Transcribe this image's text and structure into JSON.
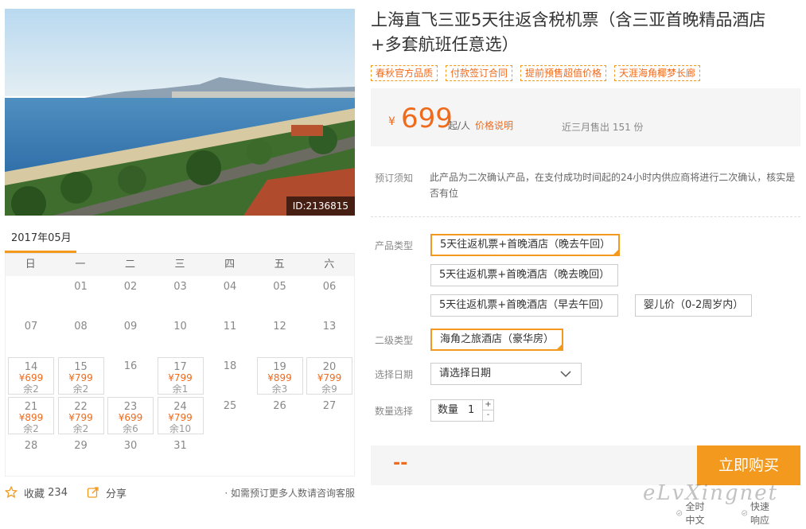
{
  "photo": {
    "id_label": "ID:2136815"
  },
  "title": "上海直飞三亚5天往返含税机票（含三亚首晚精品酒店+多套航班任意选）",
  "tags": [
    "春秋官方品质",
    "付款签订合同",
    "提前预售超值价格",
    "天涯海角椰梦长廊"
  ],
  "price": {
    "yen": "¥",
    "amount": "699",
    "unit": "起/人",
    "link": "价格说明",
    "sold": "近三月售出 151 份"
  },
  "notice": {
    "label": "预订须知",
    "text": "此产品为二次确认产品，在支付成功时间起的24小时内供应商将进行二次确认，核实是否有位"
  },
  "product_type": {
    "label": "产品类型",
    "options": [
      "5天往返机票+首晚酒店（晚去午回）",
      "5天往返机票+首晚酒店（晚去晚回）",
      "5天往返机票+首晚酒店（早去午回）",
      "婴儿价（0-2周岁内）"
    ],
    "selected_index": 0
  },
  "sub_type": {
    "label": "二级类型",
    "options": [
      "海角之旅酒店（豪华房）"
    ],
    "selected_index": 0
  },
  "date": {
    "label": "选择日期",
    "placeholder": "请选择日期"
  },
  "quantity": {
    "label": "数量选择",
    "prefix": "数量",
    "value": "1",
    "plus": "+",
    "minus": "-"
  },
  "buy": {
    "total": "--",
    "button": "立即购买"
  },
  "calendar": {
    "month": "2017年05月",
    "weekdays": [
      "日",
      "一",
      "二",
      "三",
      "四",
      "五",
      "六"
    ],
    "weeks": [
      [
        null,
        {
          "d": "01"
        },
        {
          "d": "02"
        },
        {
          "d": "03"
        },
        {
          "d": "04"
        },
        {
          "d": "05"
        },
        {
          "d": "06"
        }
      ],
      [
        {
          "d": "07"
        },
        {
          "d": "08"
        },
        {
          "d": "09"
        },
        {
          "d": "10"
        },
        {
          "d": "11"
        },
        {
          "d": "12"
        },
        {
          "d": "13"
        }
      ],
      [
        {
          "d": "14",
          "p": "¥699",
          "r": "余2"
        },
        {
          "d": "15",
          "p": "¥799",
          "r": "余2"
        },
        {
          "d": "16"
        },
        {
          "d": "17",
          "p": "¥799",
          "r": "余1"
        },
        {
          "d": "18"
        },
        {
          "d": "19",
          "p": "¥899",
          "r": "余3"
        },
        {
          "d": "20",
          "p": "¥799",
          "r": "余9"
        }
      ],
      [
        {
          "d": "21",
          "p": "¥899",
          "r": "余2"
        },
        {
          "d": "22",
          "p": "¥799",
          "r": "余2"
        },
        {
          "d": "23",
          "p": "¥699",
          "r": "余6"
        },
        {
          "d": "24",
          "p": "¥799",
          "r": "余10"
        },
        {
          "d": "25"
        },
        {
          "d": "26"
        },
        {
          "d": "27"
        }
      ],
      [
        {
          "d": "28"
        },
        {
          "d": "29"
        },
        {
          "d": "30"
        },
        {
          "d": "31"
        },
        null,
        null,
        null
      ]
    ]
  },
  "actions": {
    "favorite_label": "收藏",
    "favorite_count": "234",
    "share_label": "分享",
    "note": "· 如需预订更多人数请咨询客服"
  },
  "guarantees": [
    "全时中文",
    "快速响应"
  ],
  "watermark": "eLvXingnet",
  "colors": {
    "accent": "#f39a1e",
    "price": "#f06a1c"
  },
  "icons": {
    "favorite": "star-icon",
    "share": "share-icon",
    "dropdown": "chevron-down-icon"
  }
}
